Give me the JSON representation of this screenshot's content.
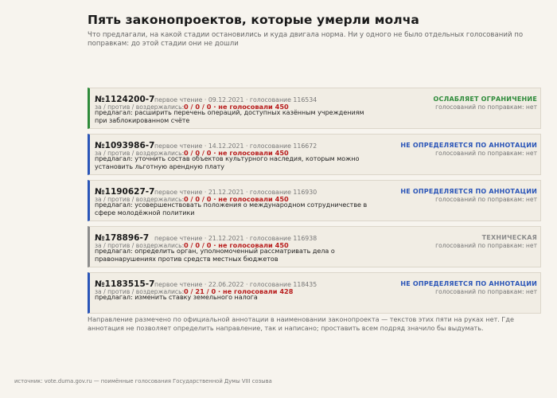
{
  "header": {
    "title": "Пять законопроектов, которые умерли молча",
    "subtitle": "Что предлагали, на какой стадии остановились и куда двигала норма. Ни у одного не было отдельных голосований по поправкам: до этой стадии они не дошли"
  },
  "colors": {
    "green": "#2e8b3a",
    "blue": "#2a55b8",
    "gray": "#8c8c8c",
    "red": "#b81d1d"
  },
  "votes_label": "за / против / воздержались:",
  "bills": [
    {
      "number": "№1124200-7",
      "meta": "первое чтение · 09.12.2021 · голосование 116534",
      "votes": "0 / 0 / 0 · не голосовали 450",
      "proposed": "предлагал: расширить перечень операций, доступных казённым учреждениям при заблокированном счёте",
      "direction": "ОСЛАБЛЯЕТ ОГРАНИЧЕНИЕ",
      "direction_color": "#2e8b3a",
      "amendments": "голосований по поправкам: нет"
    },
    {
      "number": "№1093986-7",
      "meta": "первое чтение · 14.12.2021 · голосование 116672",
      "votes": "0 / 0 / 0 · не голосовали 450",
      "proposed": "предлагал: уточнить состав объектов культурного наследия, которым можно установить льготную арендную плату",
      "direction": "НЕ ОПРЕДЕЛЯЕТСЯ ПО АННОТАЦИИ",
      "direction_color": "#2a55b8",
      "amendments": "голосований по поправкам: нет"
    },
    {
      "number": "№1190627-7",
      "meta": "первое чтение · 21.12.2021 · голосование 116930",
      "votes": "0 / 0 / 0 · не голосовали 450",
      "proposed": "предлагал: усовершенствовать положения о международном сотрудничестве в сфере молодёжной политики",
      "direction": "НЕ ОПРЕДЕЛЯЕТСЯ ПО АННОТАЦИИ",
      "direction_color": "#2a55b8",
      "amendments": "голосований по поправкам: нет"
    },
    {
      "number": "№178896-7",
      "meta": "первое чтение · 21.12.2021 · голосование 116938",
      "votes": "0 / 0 / 0 · не голосовали 450",
      "proposed": "предлагал: определить орган, уполномоченный рассматривать дела о правонарушениях против средств местных бюджетов",
      "direction": "ТЕХНИЧЕСКАЯ",
      "direction_color": "#8c8c8c",
      "amendments": "голосований по поправкам: нет"
    },
    {
      "number": "№1183515-7",
      "meta": "первое чтение · 22.06.2022 · голосование 118435",
      "votes": "0 / 21 / 0 · не голосовали 428",
      "proposed": "предлагал: изменить ставку земельного налога",
      "direction": "НЕ ОПРЕДЕЛЯЕТСЯ ПО АННОТАЦИИ",
      "direction_color": "#2a55b8",
      "amendments": "голосований по поправкам: нет"
    }
  ],
  "footnote": "Направление размечено по официальной аннотации в наименовании законопроекта — текстов этих пяти на руках нет. Где аннотация не позволяет определить направление, так и написано; проставить всем подряд значило бы выдумать.",
  "source": "источник: vote.duma.gov.ru — поимённые голосования Государственной Думы VIII созыва"
}
